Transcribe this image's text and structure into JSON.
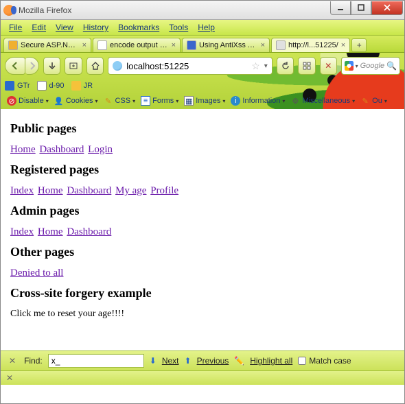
{
  "window": {
    "title": "Mozilla Firefox"
  },
  "menu": {
    "file": "File",
    "edit": "Edit",
    "view": "View",
    "history": "History",
    "bookmarks": "Bookmarks",
    "tools": "Tools",
    "help": "Help"
  },
  "tabs": [
    {
      "label": "Secure ASP.NET ...",
      "icon_color": "#f0b030"
    },
    {
      "label": "encode output us...",
      "icon_color": "#ffffff"
    },
    {
      "label": "Using AntiXss As ...",
      "icon_color": "#3a66cc"
    },
    {
      "label": "http://l...51225/",
      "icon_color": "#e0e0e0",
      "active": true
    }
  ],
  "nav": {
    "url": "localhost:51225",
    "search_placeholder": "Google"
  },
  "bookmarks": [
    {
      "label": "GTr",
      "icon": "blue-square"
    },
    {
      "label": "d-90",
      "icon": "doc"
    },
    {
      "label": "JR",
      "icon": "runner"
    }
  ],
  "devtools": [
    {
      "label": "Disable",
      "icon": "no-entry"
    },
    {
      "label": "Cookies",
      "icon": "person"
    },
    {
      "label": "CSS",
      "icon": "pencil"
    },
    {
      "label": "Forms",
      "icon": "form"
    },
    {
      "label": "Images",
      "icon": "image"
    },
    {
      "label": "Information",
      "icon": "info"
    },
    {
      "label": "Miscellaneous",
      "icon": "gear"
    },
    {
      "label": "Ou",
      "icon": "pencil"
    }
  ],
  "page": {
    "sections": [
      {
        "heading": "Public pages",
        "links": [
          "Home",
          "Dashboard",
          "Login"
        ]
      },
      {
        "heading": "Registered pages",
        "links": [
          "Index",
          "Home",
          "Dashboard",
          "My age",
          "Profile"
        ]
      },
      {
        "heading": "Admin pages",
        "links": [
          "Index",
          "Home",
          "Dashboard"
        ]
      },
      {
        "heading": "Other pages",
        "links": [
          "Denied to all"
        ]
      }
    ],
    "csrf_heading": "Cross-site forgery example",
    "csrf_text": "Click me to reset your age!!!!"
  },
  "findbar": {
    "label": "Find:",
    "value": "x_",
    "next": "Next",
    "previous": "Previous",
    "highlight": "Highlight all",
    "matchcase": "Match case"
  }
}
